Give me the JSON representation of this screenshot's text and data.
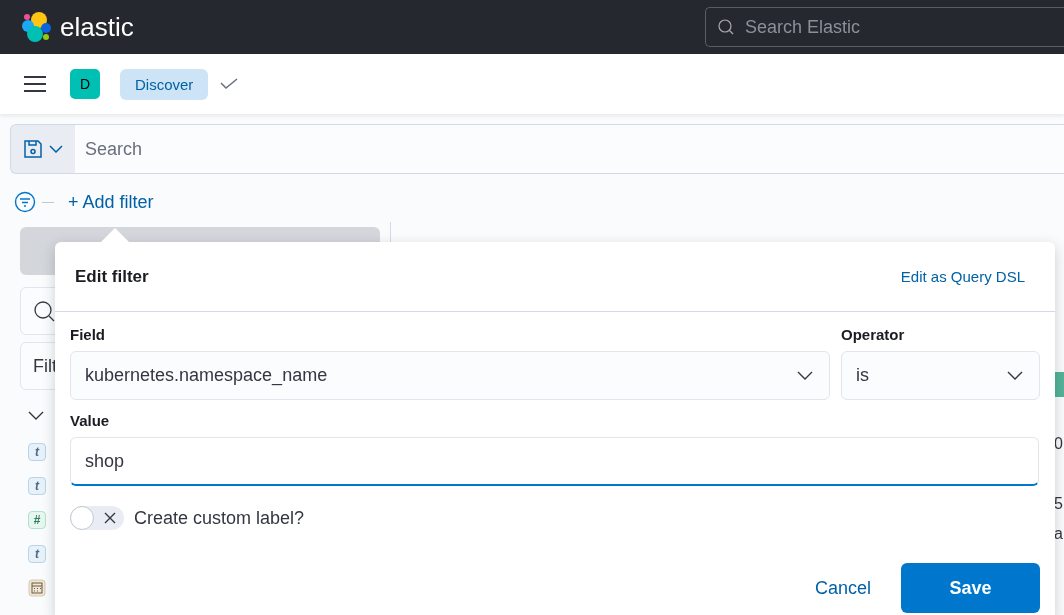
{
  "topbar": {
    "brand": "elastic",
    "search": {
      "placeholder": "Search Elastic"
    }
  },
  "header": {
    "avatar": "D",
    "breadcrumb": "Discover"
  },
  "query_bar": {
    "placeholder": "Search"
  },
  "add_filter": "+ Add filter",
  "sidebar": {
    "filter_field": {
      "value": "Filt"
    },
    "fields": [
      {
        "kind": "string",
        "token": "t"
      },
      {
        "kind": "string",
        "token": "t"
      },
      {
        "kind": "number",
        "token": "#"
      },
      {
        "kind": "string",
        "token": "t"
      },
      {
        "kind": "date"
      }
    ]
  },
  "document_table": {
    "cells": [
      "0",
      "5",
      "a"
    ]
  },
  "filter_editor": {
    "title": "Edit filter",
    "dsl_link": "Edit as Query DSL",
    "field": {
      "label": "Field",
      "value": "kubernetes.namespace_name"
    },
    "operator": {
      "label": "Operator",
      "value": "is"
    },
    "value_field": {
      "label": "Value",
      "value": "shop",
      "focused": true
    },
    "custom_label": {
      "label": "Create custom label?",
      "on": false
    },
    "buttons": {
      "cancel": "Cancel",
      "save": "Save"
    }
  }
}
